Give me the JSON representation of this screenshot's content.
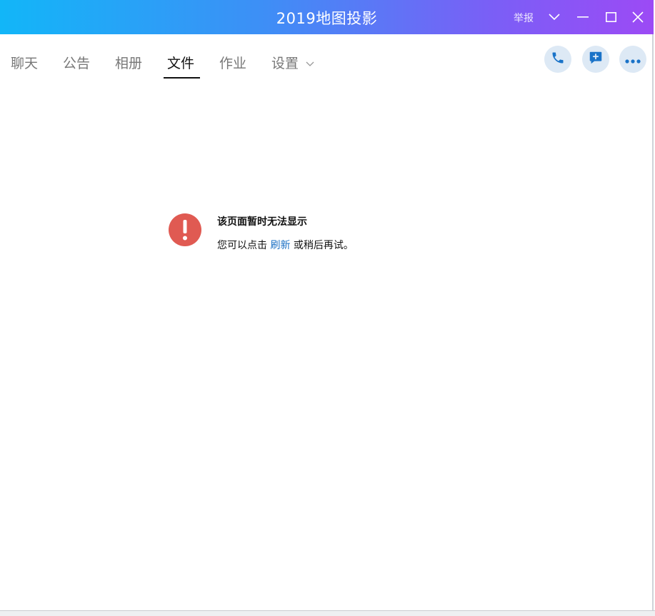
{
  "window": {
    "title": "2019地图投影",
    "report_label": "举报"
  },
  "tabs": [
    {
      "label": "聊天",
      "active": false
    },
    {
      "label": "公告",
      "active": false
    },
    {
      "label": "相册",
      "active": false
    },
    {
      "label": "文件",
      "active": true
    },
    {
      "label": "作业",
      "active": false
    },
    {
      "label": "设置",
      "active": false
    }
  ],
  "actions": {
    "call_icon": "phone-icon",
    "message_icon": "message-plus-icon",
    "more_icon": "more-dots-icon"
  },
  "error": {
    "title": "该页面暂时无法显示",
    "message_before": "您可以点击",
    "refresh_label": "刷新",
    "message_after": "或稍后再试。"
  },
  "colors": {
    "titlebar_start": "#12b6f8",
    "titlebar_end": "#9c4af5",
    "error_red": "#e05a52",
    "link_blue": "#1a6fc4",
    "action_icon_blue": "#1a73c8"
  }
}
